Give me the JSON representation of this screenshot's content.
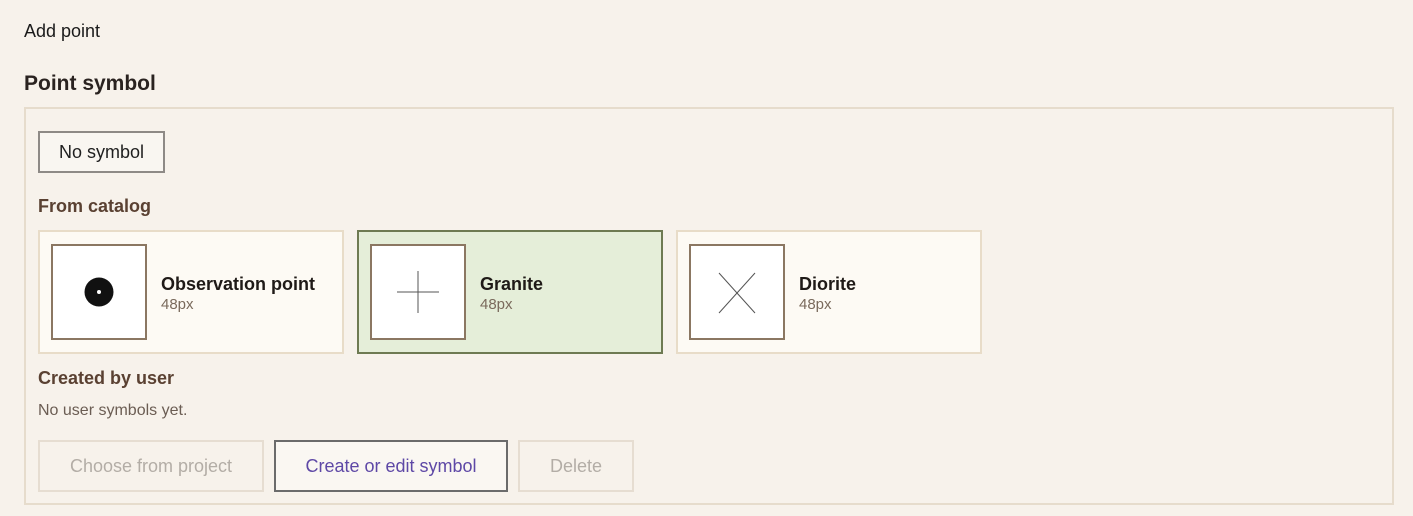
{
  "header": {
    "title": "Add point"
  },
  "point_symbol": {
    "title": "Point symbol",
    "no_symbol_label": "No symbol",
    "catalog": {
      "heading": "From catalog",
      "items": [
        {
          "name": "Observation point",
          "size": "48px",
          "icon": "filled-dot-icon",
          "selected": false
        },
        {
          "name": "Granite",
          "size": "48px",
          "icon": "plus-cross-icon",
          "selected": true
        },
        {
          "name": "Diorite",
          "size": "48px",
          "icon": "diagonal-cross-icon",
          "selected": false
        }
      ]
    },
    "user": {
      "heading": "Created by user",
      "empty_text": "No user symbols yet."
    },
    "actions": {
      "choose_label": "Choose from project",
      "create_label": "Create or edit symbol",
      "delete_label": "Delete"
    }
  },
  "colors": {
    "background": "#f7f2eb",
    "selected_card_bg": "#e5eed9",
    "selected_card_border": "#6e7a52",
    "accent_text": "#5e48a6",
    "subheading": "#5a4132"
  }
}
